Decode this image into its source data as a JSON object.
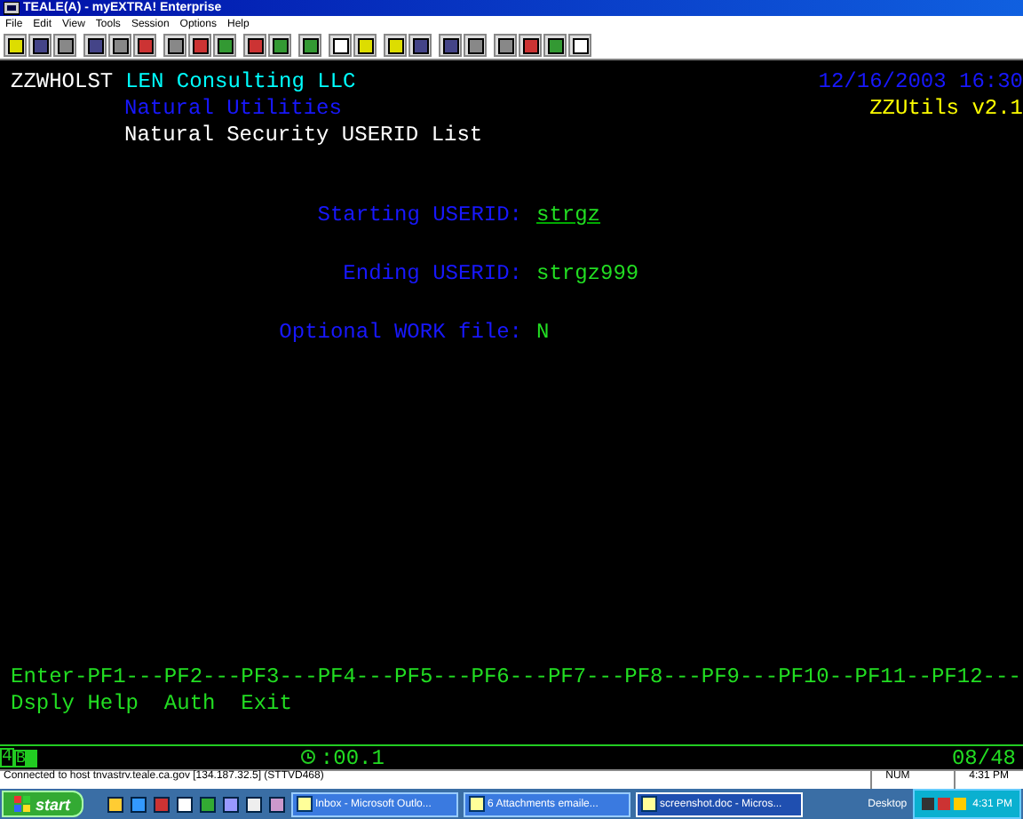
{
  "window": {
    "title": "TEALE(A) - myEXTRA! Enterprise"
  },
  "menu": [
    "File",
    "Edit",
    "View",
    "Tools",
    "Session",
    "Options",
    "Help"
  ],
  "screen": {
    "program": "ZZWHOLST",
    "company": "LEN Consulting LLC",
    "datetime": "12/16/2003 16:30",
    "subtitle": "Natural Utilities",
    "version": "ZZUtils v2.1",
    "heading": "Natural Security USERID List",
    "fields": [
      {
        "label": "Starting USERID:",
        "value": "strgz",
        "underscores": true
      },
      {
        "label": "Ending USERID:",
        "value": "strgz999",
        "underscores": false
      },
      {
        "label": "Optional WORK file:",
        "value": "N",
        "underscores": false
      }
    ],
    "pf_line": "Enter-PF1---PF2---PF3---PF4---PF5---PF6---PF7---PF8---PF9---PF10--PF11--PF12---",
    "pf_labels": "Dsply Help  Auth  Exit"
  },
  "oia": {
    "session": "4",
    "mode": "B",
    "timer": ":00.1",
    "cursor": "08/48"
  },
  "status_bar": {
    "message": "Connected to host tnvastrv.teale.ca.gov [134.187.32.5] (STTVD468)",
    "num": "NUM",
    "time": "4:31 PM"
  },
  "taskbar": {
    "start": "start",
    "tasks": [
      {
        "label": "Inbox - Microsoft Outlo...",
        "selected": false
      },
      {
        "label": "6 Attachments emaile...",
        "selected": false
      },
      {
        "label": "screenshot.doc - Micros...",
        "selected": true
      }
    ],
    "desktop": "Desktop",
    "clock": "4:31 PM"
  }
}
